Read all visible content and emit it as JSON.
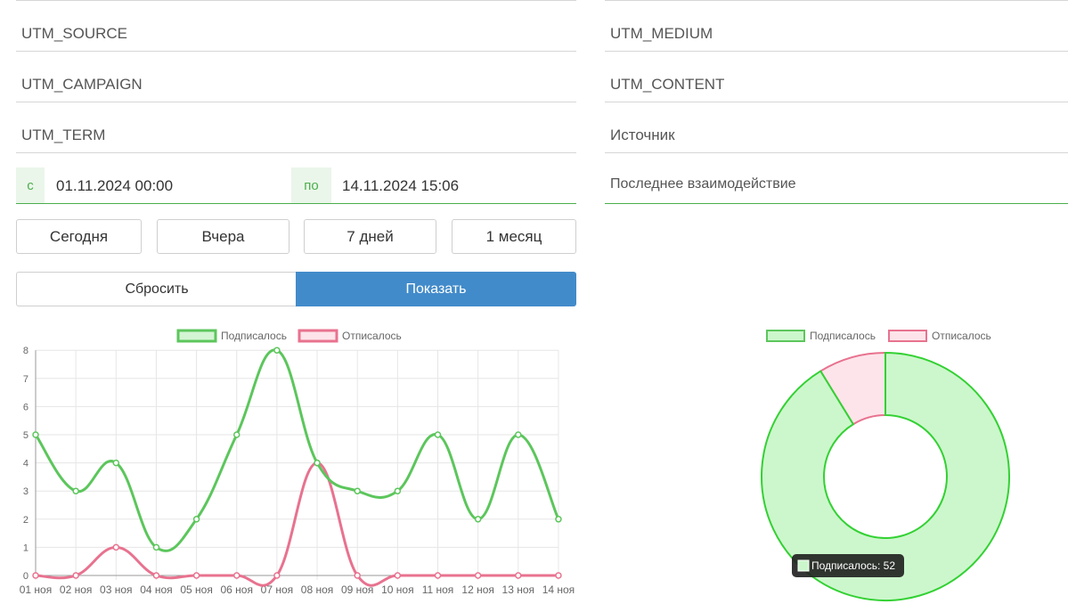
{
  "filters": {
    "utm_source": "UTM_SOURCE",
    "utm_medium": "UTM_MEDIUM",
    "utm_campaign": "UTM_CAMPAIGN",
    "utm_content": "UTM_CONTENT",
    "utm_term": "UTM_TERM",
    "source": "Источник",
    "last_interaction": "Последнее взаимодействие"
  },
  "date_range": {
    "from_prefix": "с",
    "from_value": "01.11.2024 00:00",
    "to_prefix": "по",
    "to_value": "14.11.2024 15:06"
  },
  "quick_ranges": {
    "today": "Сегодня",
    "yesterday": "Вчера",
    "week": "7 дней",
    "month": "1 месяц"
  },
  "actions": {
    "reset": "Сбросить",
    "show": "Показать"
  },
  "colors": {
    "subscribed": "#5cc65c",
    "unsubscribed": "#e8728f",
    "primary": "#428bca"
  },
  "chart_data": [
    {
      "type": "line",
      "categories": [
        "01 ноя",
        "02 ноя",
        "03 ноя",
        "04 ноя",
        "05 ноя",
        "06 ноя",
        "07 ноя",
        "08 ноя",
        "09 ноя",
        "10 ноя",
        "11 ноя",
        "12 ноя",
        "13 ноя",
        "14 ноя"
      ],
      "series": [
        {
          "name": "Подписалось",
          "values": [
            5,
            3,
            4,
            1,
            2,
            5,
            8,
            4,
            3,
            3,
            5,
            2,
            5,
            2
          ]
        },
        {
          "name": "Отписалось",
          "values": [
            0,
            0,
            1,
            0,
            0,
            0,
            0,
            4,
            0,
            0,
            0,
            0,
            0,
            0
          ]
        }
      ],
      "y_ticks": [
        "0",
        "1",
        "2",
        "3",
        "4",
        "5",
        "6",
        "7",
        "8"
      ],
      "ylim": [
        0,
        8
      ],
      "grid": true,
      "legend": "top"
    },
    {
      "type": "pie",
      "variant": "doughnut",
      "series": [
        {
          "name": "Подписалось",
          "value": 52
        },
        {
          "name": "Отписалось",
          "value": 5
        }
      ],
      "legend": "top",
      "tooltip": "Подписалось: 52"
    }
  ]
}
